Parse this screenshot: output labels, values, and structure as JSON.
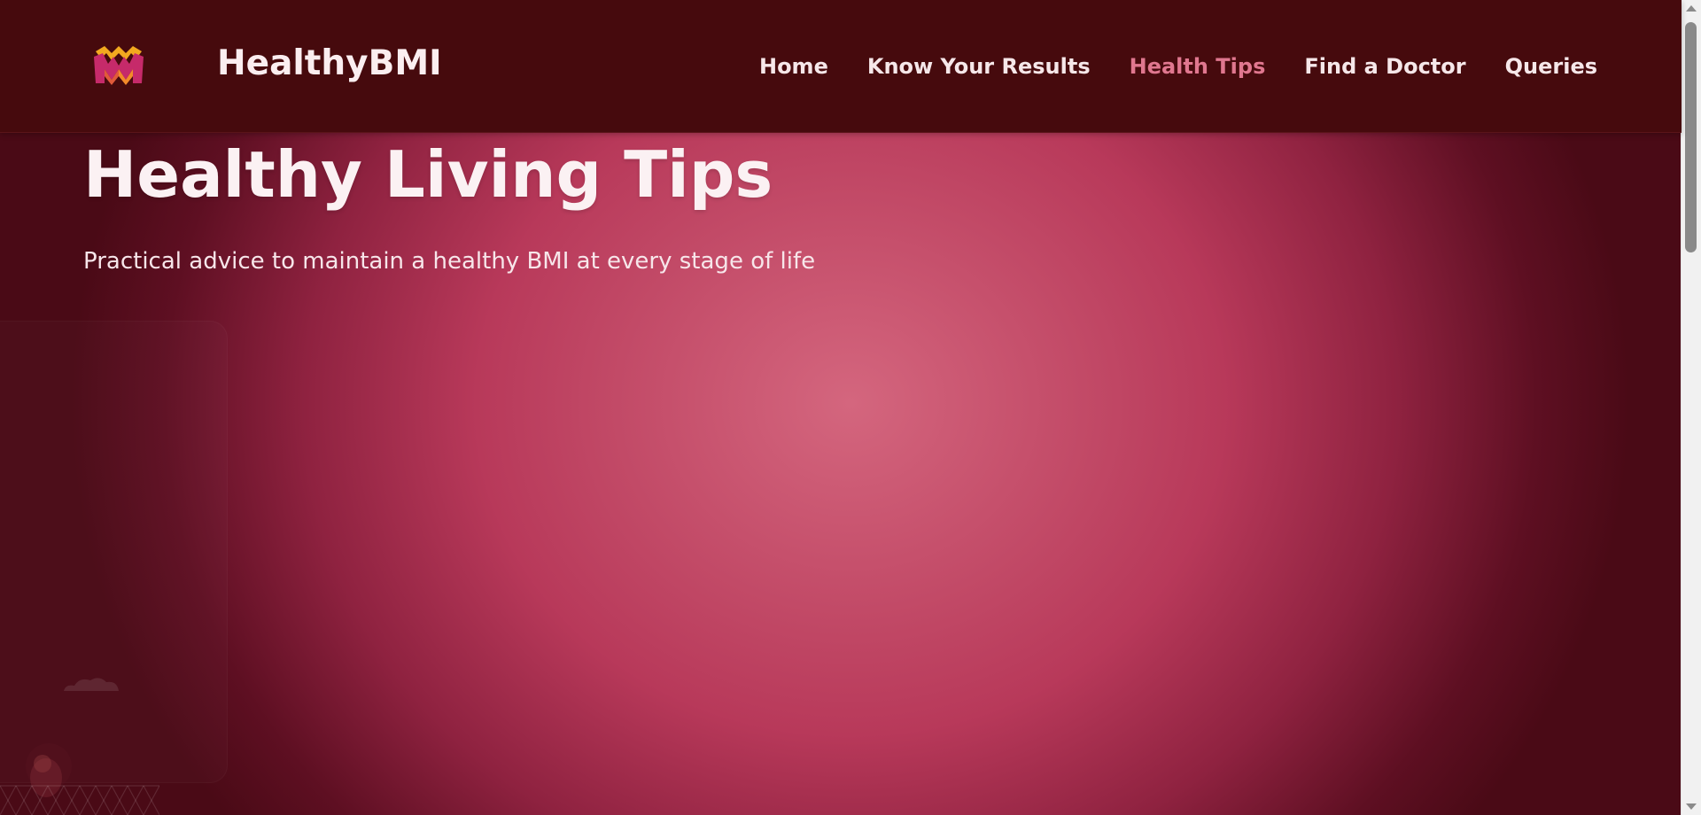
{
  "app": {
    "brand": "HealthyBMI"
  },
  "nav": {
    "items": [
      {
        "label": "Home",
        "active": false
      },
      {
        "label": "Know Your Results",
        "active": false
      },
      {
        "label": "Health Tips",
        "active": true
      },
      {
        "label": "Find a Doctor",
        "active": false
      },
      {
        "label": "Queries",
        "active": false
      }
    ]
  },
  "hero": {
    "title": "Healthy Living Tips",
    "subtitle": "Practical advice to maintain a healthy BMI at every stage of life"
  },
  "colors": {
    "navbar_bg": "#460a0d",
    "accent": "#e0778f",
    "hero_center": "#d4667e",
    "hero_edge": "#4a0a16"
  },
  "icons": {
    "logo": "crown-m-logo-icon"
  }
}
